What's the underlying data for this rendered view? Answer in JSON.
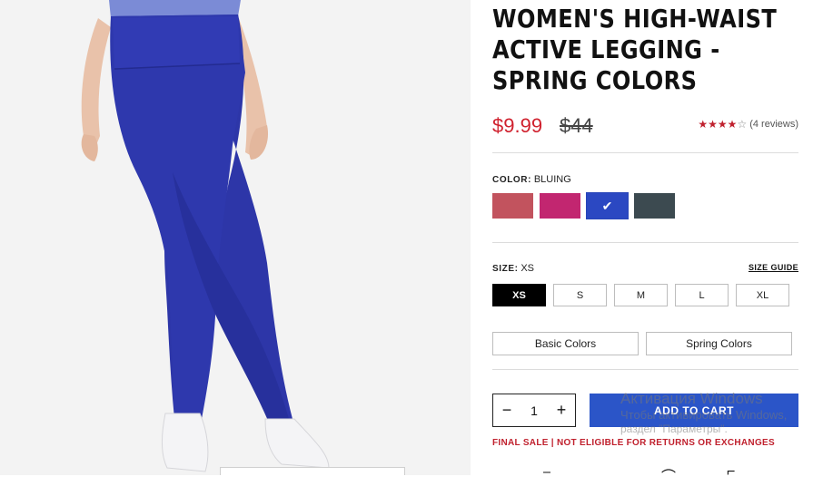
{
  "product": {
    "title": "WOMEN'S HIGH-WAIST ACTIVE LEGGING - SPRING COLORS",
    "sale_price": "$9.99",
    "original_price": "$44",
    "rating": {
      "value": 4,
      "max": 5,
      "reviews_text": "(4 reviews)"
    }
  },
  "color": {
    "label": "COLOR:",
    "selected": "BLUING",
    "swatches": [
      {
        "name": "rose",
        "hex": "#c2535e"
      },
      {
        "name": "magenta",
        "hex": "#c22670"
      },
      {
        "name": "bluing",
        "hex": "#2b48c2",
        "selected": true
      },
      {
        "name": "slate",
        "hex": "#3c4a50"
      }
    ]
  },
  "size": {
    "label": "SIZE:",
    "selected": "XS",
    "guide_label": "SIZE GUIDE",
    "options": [
      "XS",
      "S",
      "M",
      "L",
      "XL"
    ]
  },
  "collections": [
    "Basic Colors",
    "Spring Colors"
  ],
  "cart": {
    "quantity": "1",
    "minus": "−",
    "plus": "+",
    "add_label": "ADD TO CART"
  },
  "notice": "FINAL SALE | NOT ELIGIBLE FOR RETURNS OR EXCHANGES",
  "watermark": {
    "line1": "Активация Windows",
    "line2": "Чтобы активировать Windows,",
    "line3": "раздел \"Параметры\"."
  },
  "colors": {
    "accent": "#2b55c8",
    "sale": "#d0212e"
  }
}
